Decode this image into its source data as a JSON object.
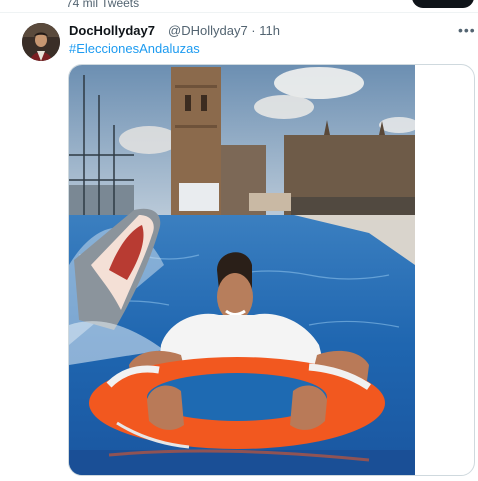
{
  "header": {
    "tweet_count": "74 mil Tweets"
  },
  "tweet": {
    "author_name": "DocHollyday7",
    "meta": "@DHollyday7 · 11h",
    "hashtag": "#EleccionesAndaluzas",
    "more_icon": "more-horizontal-icon",
    "avatar_icon": "user-avatar"
  },
  "colors": {
    "link": "#1d9bf0",
    "secondary_text": "#536471",
    "border": "#cfd9de"
  }
}
